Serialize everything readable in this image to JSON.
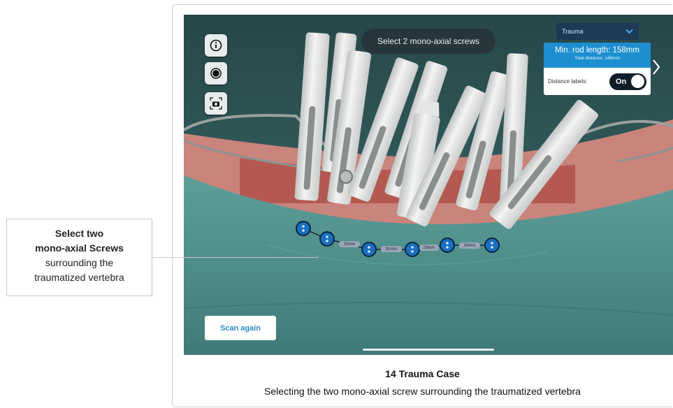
{
  "app": {
    "prompt": "Select 2 mono-axial screws",
    "case_dropdown": {
      "selected": "Trauma",
      "icon": "chevron-down-icon"
    },
    "rod_panel": {
      "title": "Min. rod length: 158mm",
      "subtitle": "Total distance: 148mm",
      "distance_labels_label": "Distance labels:",
      "toggle_state": "On"
    },
    "left_toolbar": [
      {
        "icon": "info-icon"
      },
      {
        "icon": "record-icon"
      },
      {
        "icon": "camera-capture-icon"
      }
    ],
    "scan_again_label": "Scan again",
    "distance_labels": [
      "33mm",
      "31mm",
      "29mm",
      "34mm"
    ],
    "accent_color": "#1d8fd1"
  },
  "annotation": {
    "line1": "Select two",
    "line2": "mono-axial Screws",
    "line3": "surrounding the",
    "line4": "traumatized vertebra"
  },
  "caption": {
    "title": "14 Trauma Case",
    "subtitle": "Selecting the two mono-axial screw surrounding the traumatized vertebra"
  }
}
